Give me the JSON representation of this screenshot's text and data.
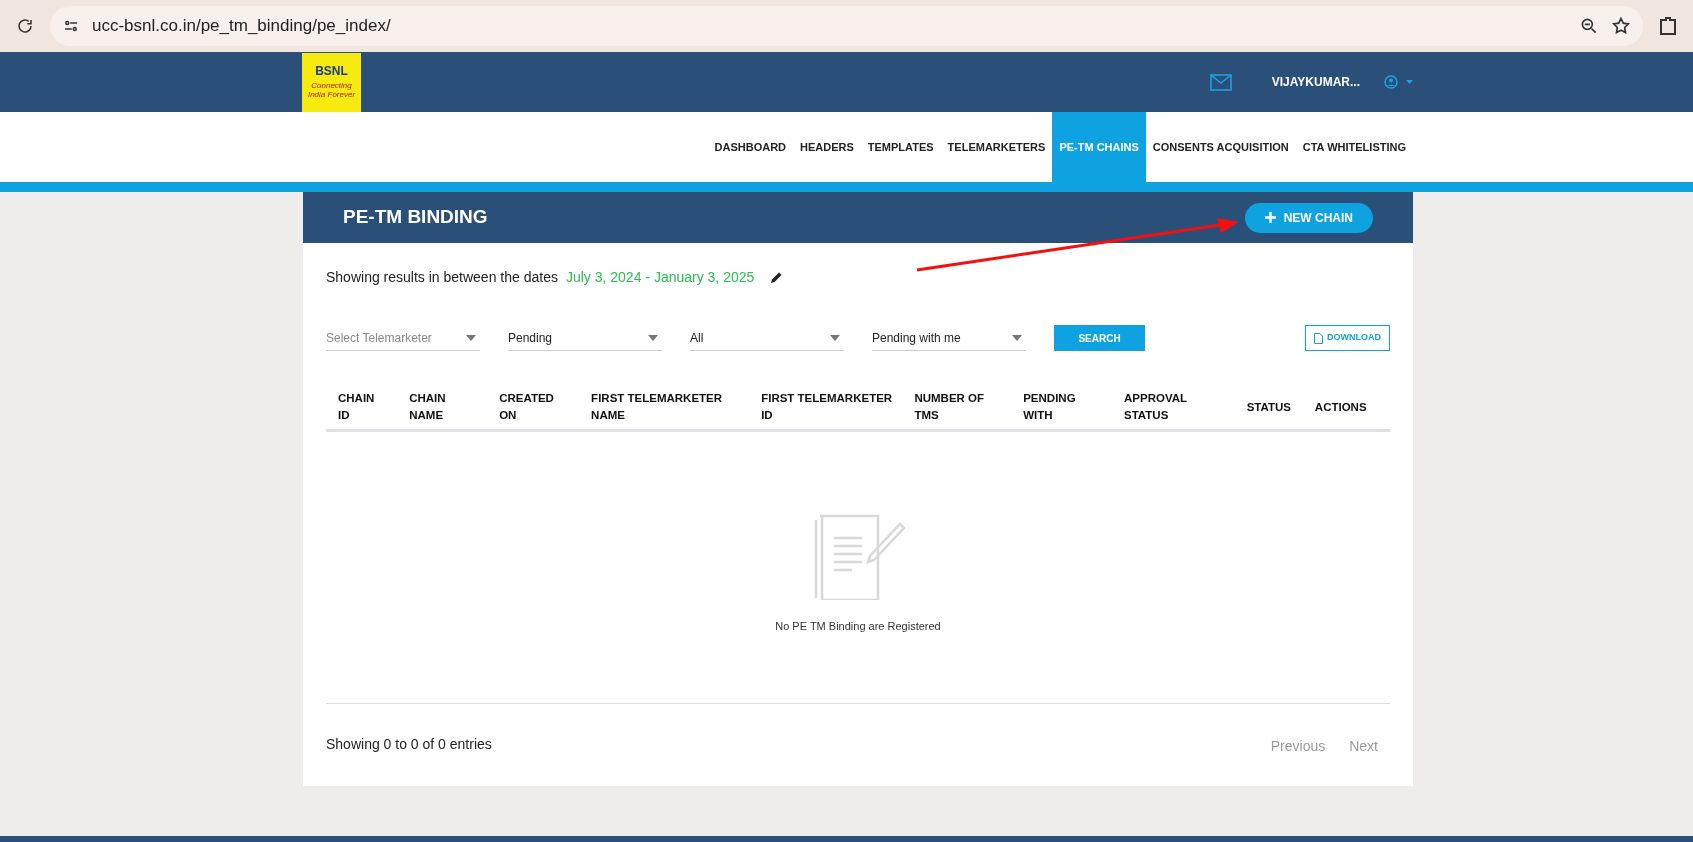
{
  "browser": {
    "url": "ucc-bsnl.co.in/pe_tm_binding/pe_index/"
  },
  "header": {
    "logo": {
      "name": "BSNL",
      "tagline": "Connecting India Forever"
    },
    "user": "VIJAYKUMAR..."
  },
  "nav": [
    {
      "label": "DASHBOARD",
      "selected": false
    },
    {
      "label": "HEADERS",
      "selected": false
    },
    {
      "label": "TEMPLATES",
      "selected": false
    },
    {
      "label": "TELEMARKETERS",
      "selected": false
    },
    {
      "label": "PE-TM CHAINS",
      "selected": true
    },
    {
      "label": "CONSENTS ACQUISITION",
      "selected": false
    },
    {
      "label": "CTA WHITELISTING",
      "selected": false
    }
  ],
  "card": {
    "title": "PE-TM BINDING",
    "new_button": "NEW CHAIN",
    "date_prefix": "Showing results in between the dates",
    "date_range": "July 3, 2024 - January 3, 2025",
    "filters": [
      {
        "placeholder": "Select Telemarketer"
      },
      {
        "value": "Pending"
      },
      {
        "value": "All"
      },
      {
        "value": "Pending with me"
      }
    ],
    "search_button": "SEARCH",
    "download_button": "DOWNLOAD",
    "table": {
      "columns": [
        [
          "CHAIN",
          "ID"
        ],
        [
          "CHAIN",
          "NAME"
        ],
        [
          "CREATED",
          "ON"
        ],
        [
          "FIRST TELEMARKETER",
          "NAME"
        ],
        [
          "FIRST TELEMARKETER",
          "ID"
        ],
        [
          "NUMBER OF",
          "TMS"
        ],
        [
          "PENDING",
          "WITH"
        ],
        [
          "APPROVAL",
          "STATUS"
        ],
        [
          "STATUS"
        ],
        [
          "ACTIONS"
        ]
      ],
      "empty_message": "No PE TM Binding are Registered"
    },
    "footer": {
      "info": "Showing 0 to 0 of 0 entries",
      "previous": {
        "label": "Previous",
        "disabled": true
      },
      "next": {
        "label": "Next",
        "disabled": true
      }
    }
  }
}
